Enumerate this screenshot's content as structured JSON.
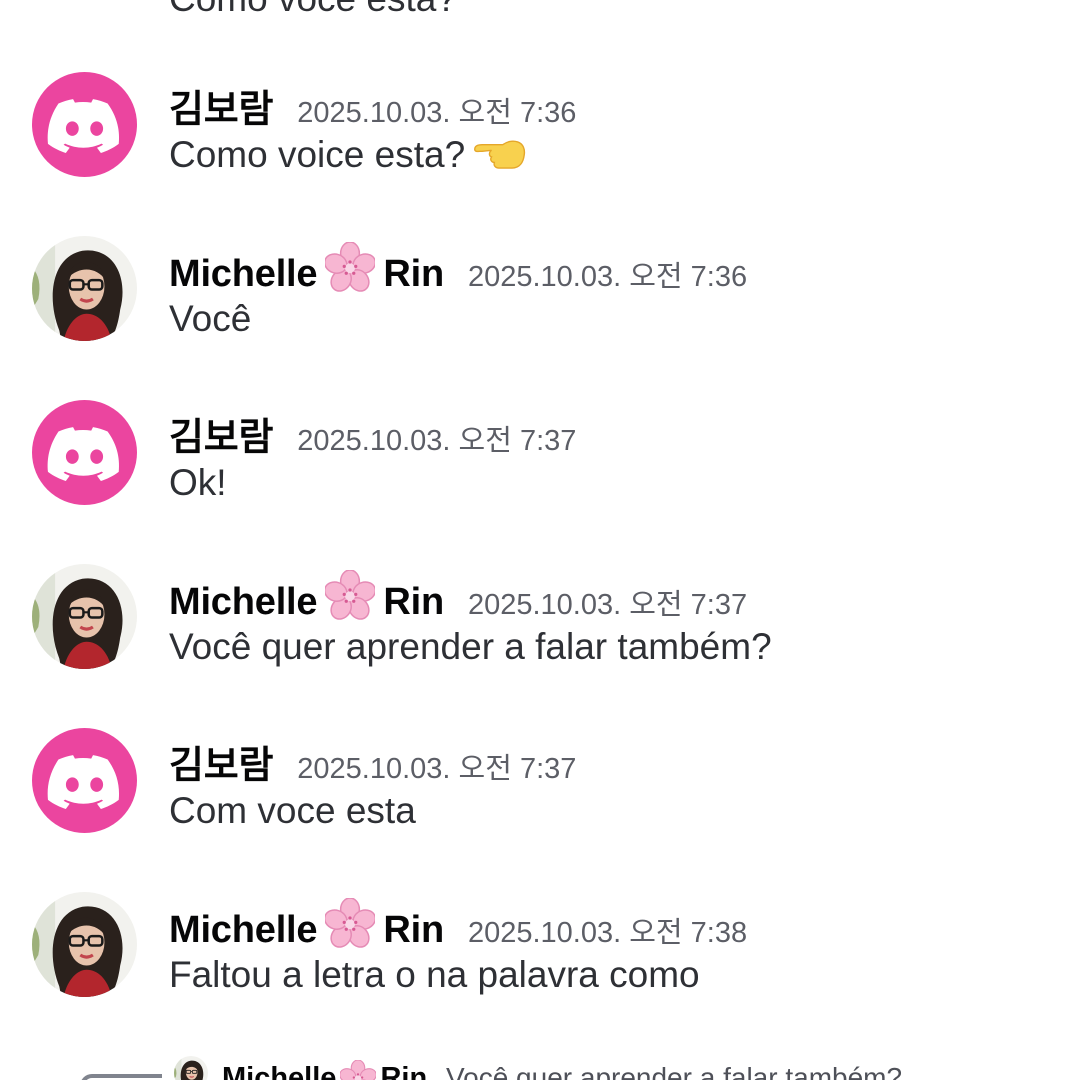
{
  "cut_message": "Como voce esta?",
  "messages": [
    {
      "author": "김보람",
      "kind": "discord",
      "time": "2025.10.03. 오전 7:36",
      "text": "Como voice esta?",
      "emoji": "backhand-index-pointing-left"
    },
    {
      "author_first": "Michelle",
      "author_last": "Rin",
      "kind": "photo",
      "time": "2025.10.03. 오전 7:36",
      "text": "Você"
    },
    {
      "author": "김보람",
      "kind": "discord",
      "time": "2025.10.03. 오전 7:37",
      "text": "Ok!"
    },
    {
      "author_first": "Michelle",
      "author_last": "Rin",
      "kind": "photo",
      "time": "2025.10.03. 오전 7:37",
      "text": "Você quer aprender a falar também?"
    },
    {
      "author": "김보람",
      "kind": "discord",
      "time": "2025.10.03. 오전 7:37",
      "text": "Com voce esta"
    },
    {
      "author_first": "Michelle",
      "author_last": "Rin",
      "kind": "photo",
      "time": "2025.10.03. 오전 7:38",
      "text": "Faltou a letra o na palavra como"
    }
  ],
  "reply": {
    "author_first": "Michelle",
    "author_last": "Rin",
    "text": "Você quer aprender a falar também?"
  },
  "colors": {
    "discord_avatar": "#eb459f",
    "timestamp": "#5c5e66",
    "message_text": "#2e3035",
    "author_text": "#060607"
  },
  "icons": {
    "discord_avatar": "discord-logo-icon",
    "flower": "cherry-blossom-icon"
  }
}
